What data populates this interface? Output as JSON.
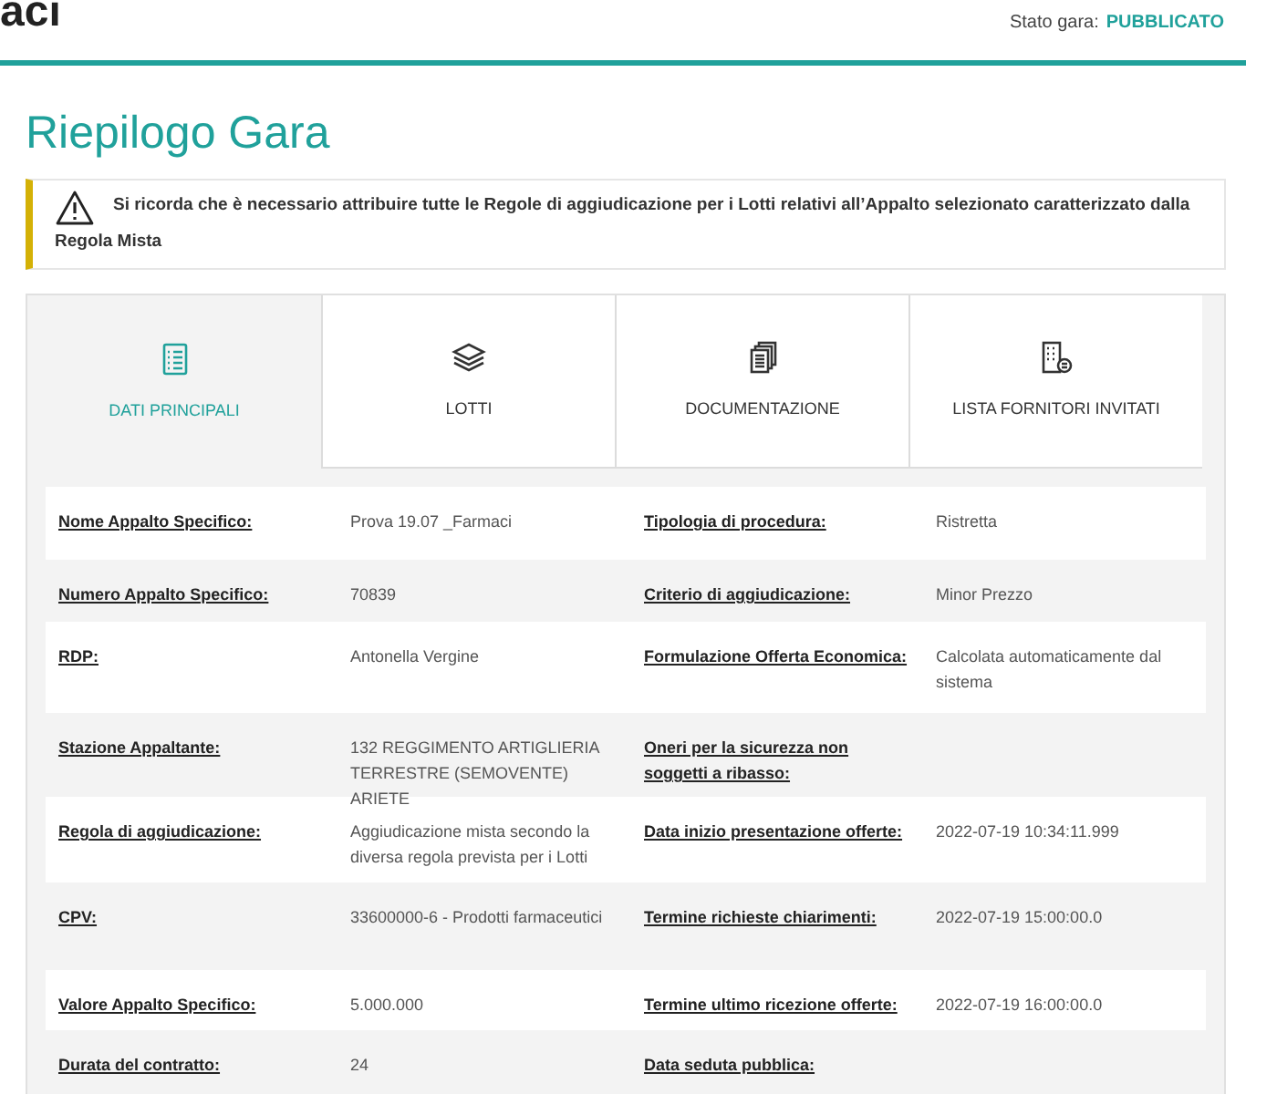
{
  "header": {
    "title": "aci",
    "status_label": "Stato gara:",
    "status_value": "PUBBLICATO"
  },
  "page_title": "Riepilogo Gara",
  "alert": {
    "text": "Si ricorda che è necessario attribuire tutte le Regole di aggiudicazione per i Lotti relativi all’Appalto selezionato caratterizzato dalla Regola Mista"
  },
  "tabs": [
    {
      "label": "DATI PRINCIPALI",
      "kind": "list",
      "selected": true
    },
    {
      "label": "LOTTI",
      "kind": "layers",
      "selected": false
    },
    {
      "label": "DOCUMENTAZIONE",
      "kind": "documents",
      "selected": false
    },
    {
      "label": "LISTA FORNITORI INVITATI",
      "kind": "building",
      "selected": false
    }
  ],
  "rows": [
    {
      "left": {
        "label": "Nome Appalto Specifico:",
        "value": "Prova 19.07 _Farmaci"
      },
      "right": {
        "label": "Tipologia di procedura:",
        "value": "Ristretta"
      }
    },
    {
      "left": {
        "label": "Numero Appalto Specifico:",
        "value": "70839"
      },
      "right": {
        "label": "Criterio di aggiudicazione:",
        "value": "Minor Prezzo"
      }
    },
    {
      "left": {
        "label": "RDP:",
        "value": "Antonella Vergine"
      },
      "right": {
        "label": "Formulazione Offerta Economica:",
        "value": "Calcolata automaticamente dal sistema"
      }
    },
    {
      "left": {
        "label": "Stazione Appaltante:",
        "value": "132 REGGIMENTO ARTIGLIERIA TERRESTRE (SEMOVENTE) ARIETE"
      },
      "right": {
        "label": "Oneri per la sicurezza non soggetti a ribasso:"
      }
    },
    {
      "left": {
        "label": "Regola di aggiudicazione:",
        "value": "Aggiudicazione mista secondo la diversa regola prevista per i Lotti"
      },
      "right": {
        "label": "Data inizio presentazione offerte:",
        "value": "2022-07-19 10:34:11.999"
      }
    },
    {
      "left": {
        "label": "CPV:",
        "value": "33600000-6 - Prodotti farmaceutici"
      },
      "right": {
        "label": "Termine richieste chiarimenti:",
        "value": "2022-07-19 15:00:00.0"
      }
    },
    {
      "left": {
        "label": "Valore Appalto Specifico:",
        "value": "5.000.000"
      },
      "right": {
        "label": "Termine ultimo ricezione offerte:",
        "value": "2022-07-19 16:00:00.0"
      }
    },
    {
      "left": {
        "label": "Durata del contratto:",
        "value": "24"
      },
      "right": {
        "label": "Data seduta pubblica:"
      }
    }
  ]
}
